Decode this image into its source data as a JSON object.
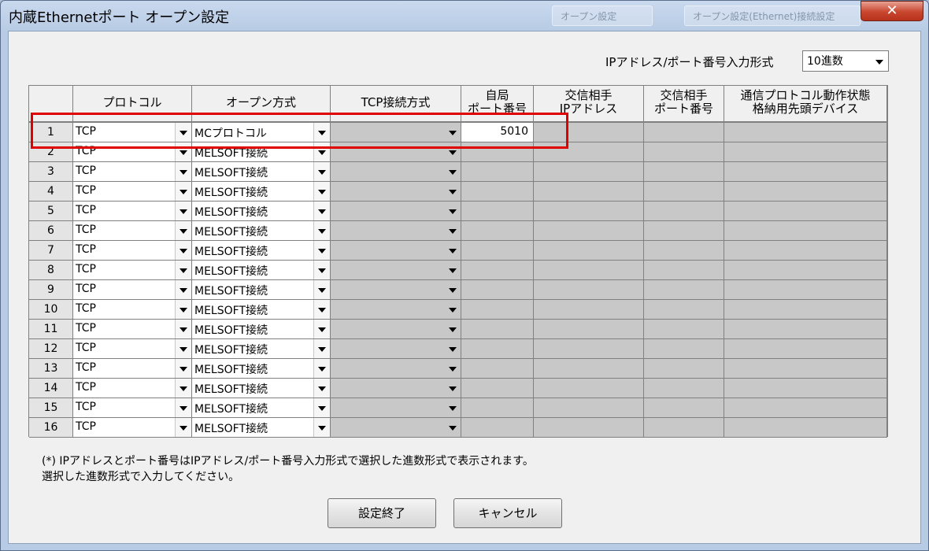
{
  "window": {
    "title": "内蔵Ethernetポート オープン設定",
    "ghost_buttons": [
      "オープン設定",
      "オープン設定(Ethernet)接続設定"
    ],
    "close_symbol": "✕"
  },
  "ip_format": {
    "label": "IPアドレス/ポート番号入力形式",
    "selected": "10進数"
  },
  "table": {
    "headers": {
      "protocol": [
        "プロトコル"
      ],
      "open_method": [
        "オープン方式"
      ],
      "tcp_method": [
        "TCP接続方式"
      ],
      "local_port": [
        "自局",
        "ポート番号"
      ],
      "remote_ip": [
        "交信相手",
        "IPアドレス"
      ],
      "remote_port": [
        "交信相手",
        "ポート番号"
      ],
      "device": [
        "通信プロトコル動作状態",
        "格納用先頭デバイス"
      ]
    },
    "rows": [
      {
        "no": "1",
        "protocol": "TCP",
        "open_method": "MCプロトコル",
        "local_port": "5010"
      },
      {
        "no": "2",
        "protocol": "TCP",
        "open_method": "MELSOFT接続",
        "local_port": ""
      },
      {
        "no": "3",
        "protocol": "TCP",
        "open_method": "MELSOFT接続",
        "local_port": ""
      },
      {
        "no": "4",
        "protocol": "TCP",
        "open_method": "MELSOFT接続",
        "local_port": ""
      },
      {
        "no": "5",
        "protocol": "TCP",
        "open_method": "MELSOFT接続",
        "local_port": ""
      },
      {
        "no": "6",
        "protocol": "TCP",
        "open_method": "MELSOFT接続",
        "local_port": ""
      },
      {
        "no": "7",
        "protocol": "TCP",
        "open_method": "MELSOFT接続",
        "local_port": ""
      },
      {
        "no": "8",
        "protocol": "TCP",
        "open_method": "MELSOFT接続",
        "local_port": ""
      },
      {
        "no": "9",
        "protocol": "TCP",
        "open_method": "MELSOFT接続",
        "local_port": ""
      },
      {
        "no": "10",
        "protocol": "TCP",
        "open_method": "MELSOFT接続",
        "local_port": ""
      },
      {
        "no": "11",
        "protocol": "TCP",
        "open_method": "MELSOFT接続",
        "local_port": ""
      },
      {
        "no": "12",
        "protocol": "TCP",
        "open_method": "MELSOFT接続",
        "local_port": ""
      },
      {
        "no": "13",
        "protocol": "TCP",
        "open_method": "MELSOFT接続",
        "local_port": ""
      },
      {
        "no": "14",
        "protocol": "TCP",
        "open_method": "MELSOFT接続",
        "local_port": ""
      },
      {
        "no": "15",
        "protocol": "TCP",
        "open_method": "MELSOFT接続",
        "local_port": ""
      },
      {
        "no": "16",
        "protocol": "TCP",
        "open_method": "MELSOFT接続",
        "local_port": ""
      }
    ]
  },
  "note": {
    "line1": "(*) IPアドレスとポート番号はIPアドレス/ポート番号入力形式で選択した進数形式で表示されます。",
    "line2": "選択した進数形式で入力してください。"
  },
  "buttons": {
    "ok": "設定終了",
    "cancel": "キャンセル"
  },
  "colors": {
    "highlight": "#e00000",
    "disabled_cell": "#c8c8c8",
    "titlebar": "#b7cbe4"
  }
}
